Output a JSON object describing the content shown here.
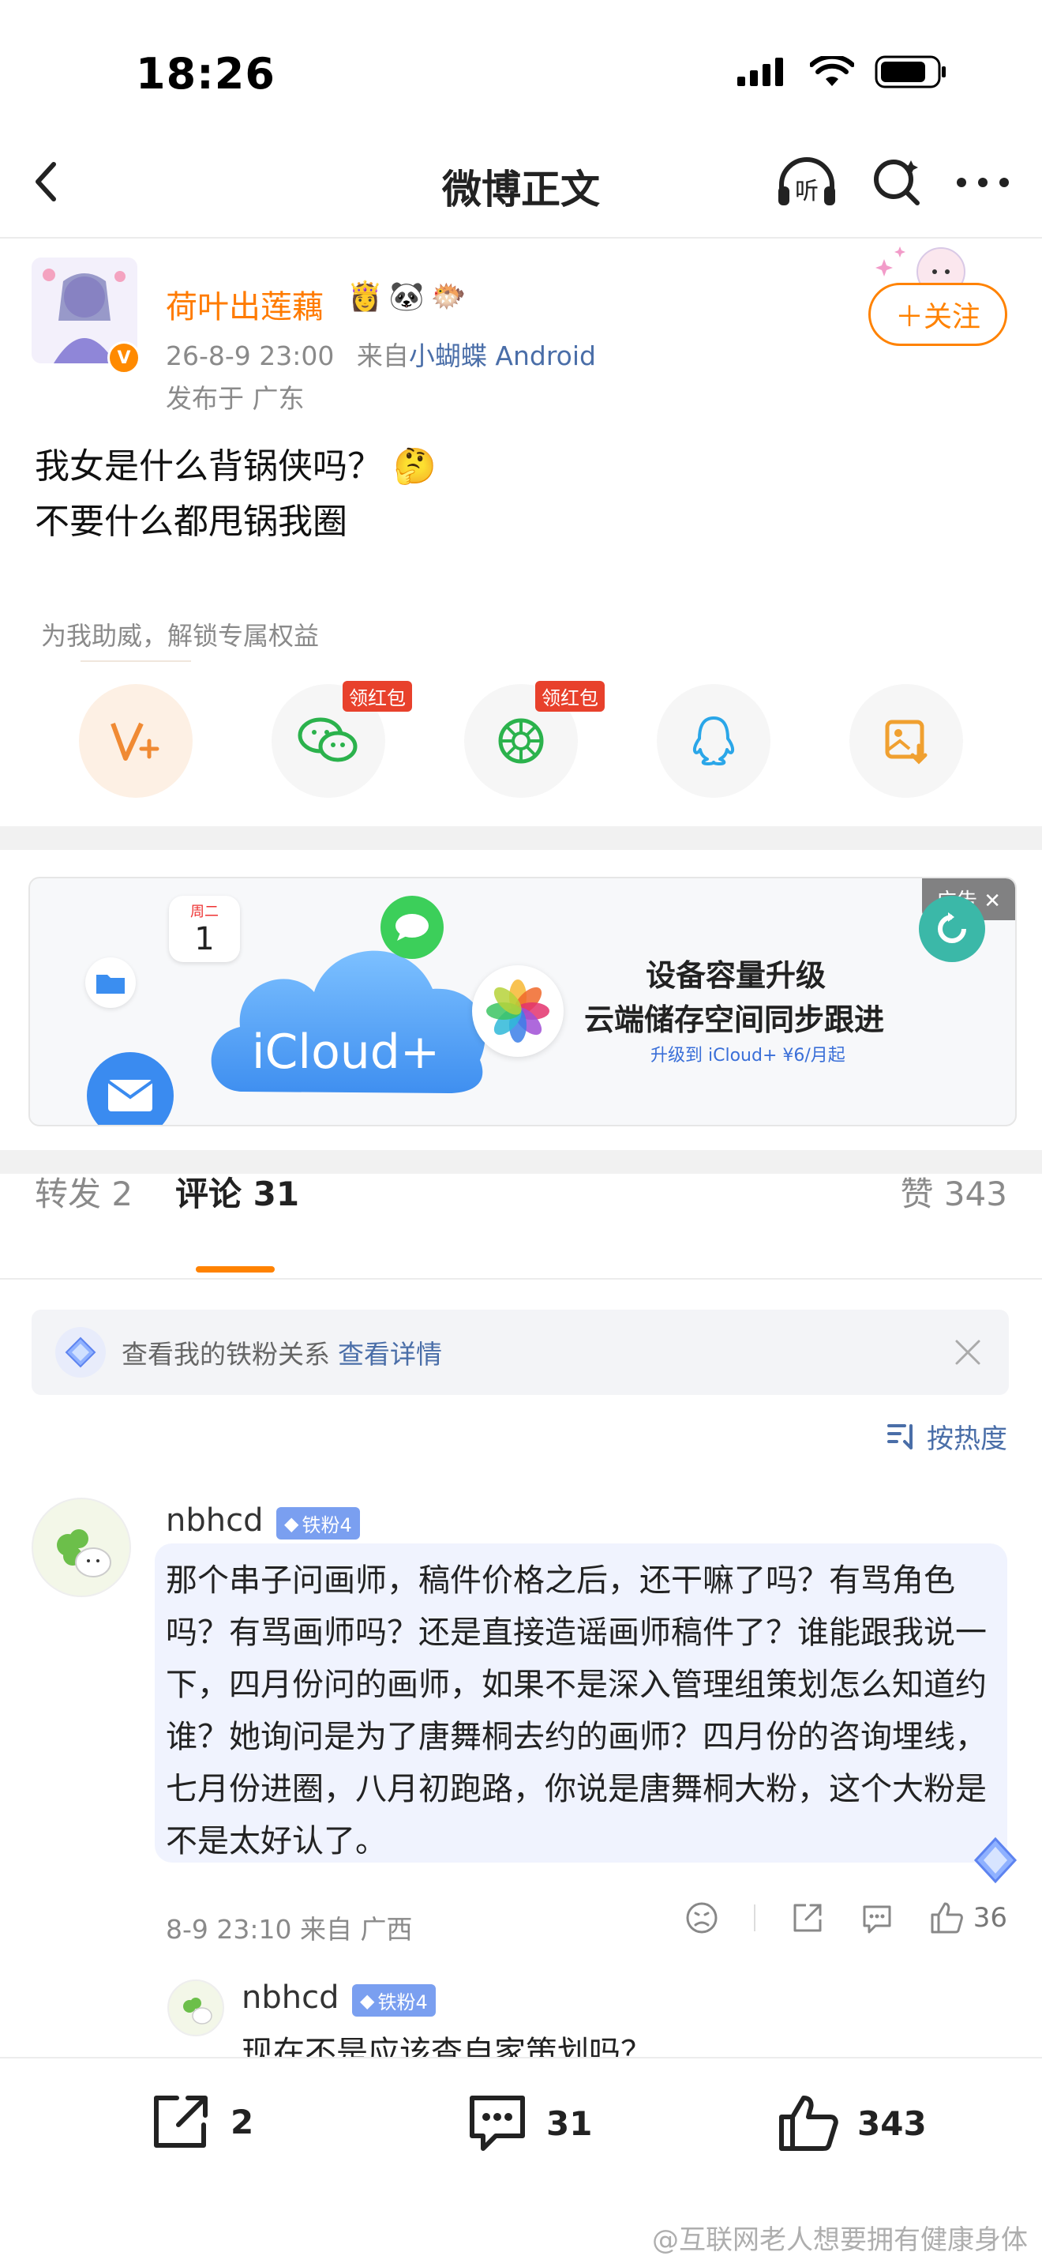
{
  "status_bar": {
    "time": "18:26"
  },
  "nav": {
    "title": "微博正文"
  },
  "post": {
    "author": "荷叶出莲藕",
    "badges": [
      "👸",
      "🐼",
      "🐡"
    ],
    "time": "26-8-9 23:00",
    "source_prefix": "来自",
    "source": "小蝴蝶 Android",
    "location": "发布于 广东",
    "follow_label": "＋关注",
    "text_line1": "我女是什么背锅侠吗？ 🤔",
    "text_line2": "不要什么都甩锅我圈",
    "boost_label": "为我助威，解锁专属权益",
    "redpack_label": "领红包"
  },
  "ad": {
    "tag": "广告 ✕",
    "calendar_day": "周二",
    "calendar_num": "1",
    "product": "iCloud+",
    "title1": "设备容量升级",
    "title2": "云端储存空间同步跟进",
    "sub": "升级到 iCloud+ ¥6/月起"
  },
  "tabs": {
    "repost": "转发 2",
    "comment": "评论 31",
    "like": "赞 343"
  },
  "fan_banner": {
    "text": "查看我的铁粉关系",
    "link": "查看详情"
  },
  "sort_label": "按热度",
  "comment": {
    "name": "nbhcd",
    "badge": "铁粉4",
    "text": "那个串子问画师，稿件价格之后，还干嘛了吗？有骂角色吗？有骂画师吗？还是直接造谣画师稿件了？谁能跟我说一下，四月份问的画师，如果不是深入管理组策划怎么知道约谁？她询问是为了唐舞桐去约的画师？四月份的咨询埋线，七月份进圈，八月初跑路，你说是唐舞桐大粉，这个大粉是不是太好认了。",
    "meta": "8-9 23:10 来自 广西",
    "likes": "36",
    "reply_name": "nbhcd",
    "reply_badge": "铁粉4",
    "reply_text": "现在不是应该查自家策划吗？"
  },
  "bottom_bar": {
    "repost_count": "2",
    "comment_count": "31",
    "like_count": "343"
  },
  "watermark": "@互联网老人想要拥有健康身体"
}
